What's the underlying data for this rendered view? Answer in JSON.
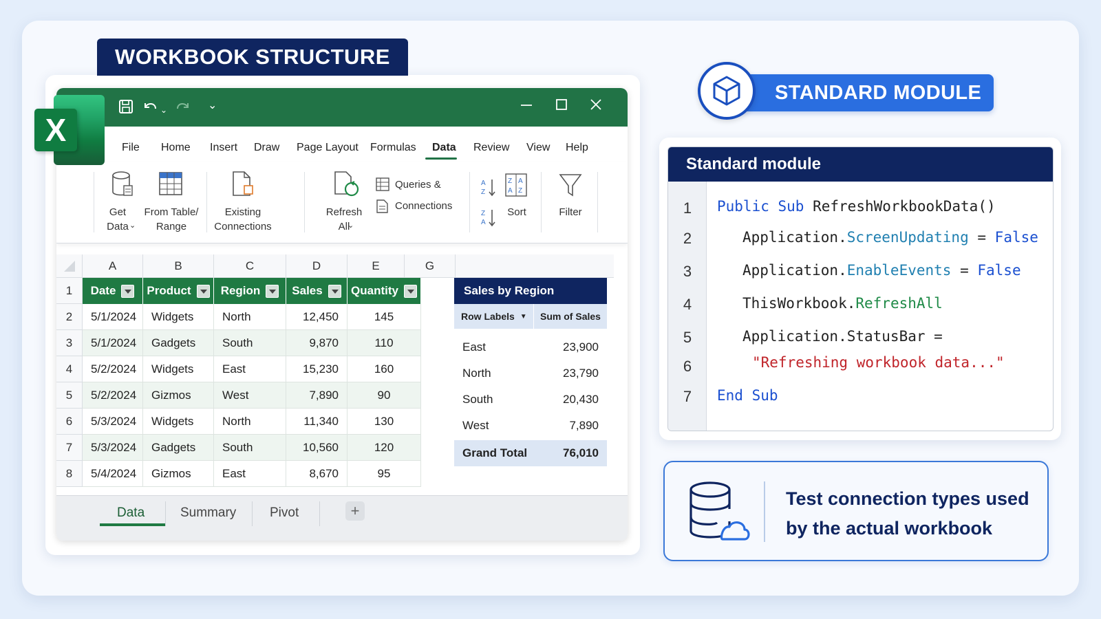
{
  "workbook_title": "WORKBOOK STRUCTURE",
  "excel": {
    "logo_letter": "X",
    "menu": [
      "File",
      "Home",
      "Insert",
      "Draw",
      "Page Layout",
      "Formulas",
      "Data",
      "Review",
      "View",
      "Help"
    ],
    "active_menu": "Data",
    "ribbon": {
      "get_data": "Get\nData",
      "from_table": "From Table/\nRange",
      "existing_connections": "Existing\nConnections",
      "refresh_all": "Refresh\nAll",
      "queries": "Queries &",
      "connections": "Connections",
      "sort": "Sort",
      "filter": "Filter"
    },
    "columns": [
      "A",
      "B",
      "C",
      "D",
      "E",
      "G"
    ],
    "headers": [
      "Date",
      "Product",
      "Region",
      "Sales",
      "Quantity"
    ],
    "rows": [
      [
        "5/1/2024",
        "Widgets",
        "North",
        "12,450",
        "145"
      ],
      [
        "5/1/2024",
        "Gadgets",
        "South",
        "9,870",
        "110"
      ],
      [
        "5/2/2024",
        "Widgets",
        "East",
        "15,230",
        "160"
      ],
      [
        "5/2/2024",
        "Gizmos",
        "West",
        "7,890",
        "90"
      ],
      [
        "5/3/2024",
        "Widgets",
        "North",
        "11,340",
        "130"
      ],
      [
        "5/3/2024",
        "Gadgets",
        "South",
        "10,560",
        "120"
      ],
      [
        "5/4/2024",
        "Gizmos",
        "East",
        "8,670",
        "95"
      ]
    ],
    "row_numbers": [
      "1",
      "2",
      "3",
      "4",
      "5",
      "6",
      "7",
      "8"
    ],
    "pivot": {
      "title": "Sales by Region",
      "row_labels": "Row Labels",
      "sum_label": "Sum of Sales",
      "rows": [
        [
          "East",
          "23,900"
        ],
        [
          "North",
          "23,790"
        ],
        [
          "South",
          "20,430"
        ],
        [
          "West",
          "7,890"
        ]
      ],
      "total_label": "Grand Total",
      "total_value": "76,010"
    },
    "sheets": [
      "Data",
      "Summary",
      "Pivot"
    ],
    "active_sheet": "Data",
    "add_sheet": "+"
  },
  "module": {
    "banner": "STANDARD MODULE",
    "code_title": "Standard module",
    "line_numbers": [
      "1",
      "2",
      "3",
      "4",
      "5",
      "6",
      "7"
    ],
    "code": {
      "l1_kw1": "Public",
      "l1_kw2": "Sub",
      "l1_name": "RefreshWorkbookData()",
      "l2_obj": "Application.",
      "l2_prop": "ScreenUpdating",
      "l2_eq": " = ",
      "l2_val": "False",
      "l3_obj": "Application.",
      "l3_prop": "EnableEvents",
      "l3_eq": " = ",
      "l3_val": "False",
      "l4_obj": "ThisWorkbook.",
      "l4_meth": "RefreshAll",
      "l5": "Application.StatusBar =",
      "l6_str": "\"Refreshing workbook data...\"",
      "l7_kw1": "End",
      "l7_kw2": "Sub"
    }
  },
  "info": {
    "text": "Test connection types used by the actual workbook",
    "icon": "database-cloud-icon"
  },
  "colors": {
    "excel_green": "#217346",
    "navy": "#0f2560",
    "accent_blue": "#2a6ee0"
  }
}
